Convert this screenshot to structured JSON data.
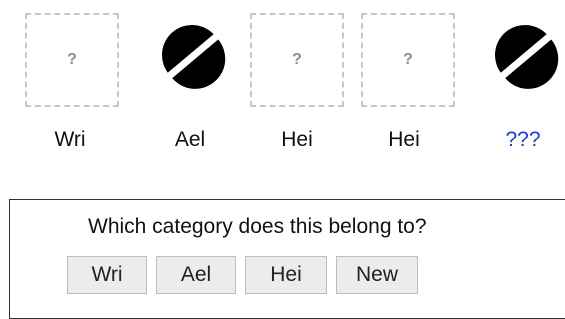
{
  "examples": [
    {
      "label": "Wri",
      "image": "placeholder",
      "placeholder_text": "?"
    },
    {
      "label": "Ael",
      "image": "split-semicircle-shape",
      "placeholder_text": ""
    },
    {
      "label": "Hei",
      "image": "placeholder",
      "placeholder_text": "?"
    },
    {
      "label": "Hei",
      "image": "placeholder",
      "placeholder_text": "?"
    },
    {
      "label": "???",
      "image": "split-semicircle-shape",
      "placeholder_text": ""
    }
  ],
  "question": {
    "prompt": "Which category does this belong to?",
    "choices": [
      "Wri",
      "Ael",
      "Hei",
      "New"
    ]
  },
  "colors": {
    "unknown_label": "#1f36e6",
    "shape_fill": "#000000",
    "placeholder_border": "#c7c7c7",
    "button_bg": "#ececec"
  }
}
